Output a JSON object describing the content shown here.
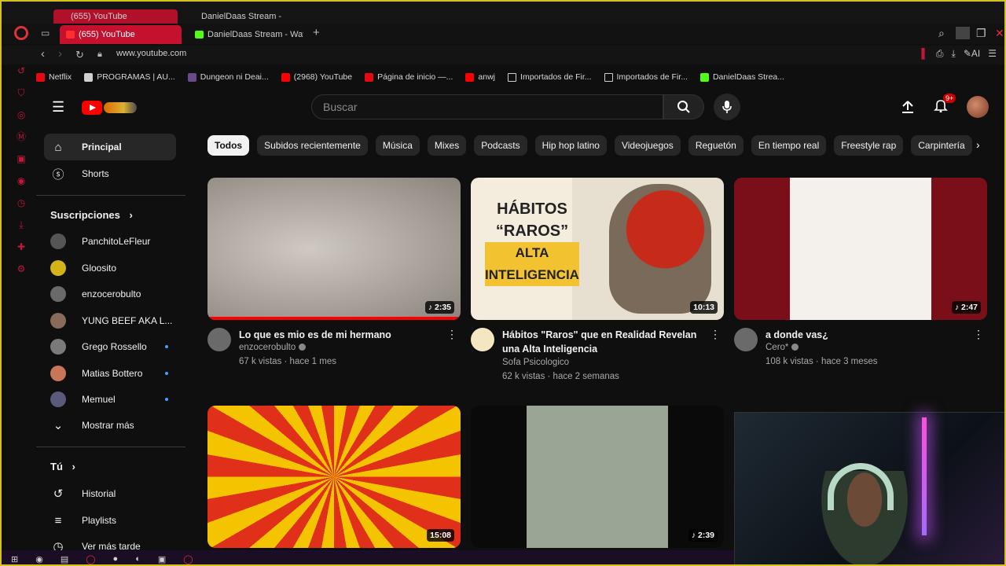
{
  "ghost_tabs": [
    "(655) YouTube",
    "DanielDaas Stream - Watc"
  ],
  "browser": {
    "tabs": [
      {
        "label": "(655) YouTube",
        "active": true
      },
      {
        "label": "DanielDaas Stream - Watc",
        "active": false
      }
    ],
    "url": "www.youtube.com"
  },
  "bookmarks": [
    {
      "label": "Netflix",
      "color": "#e50914"
    },
    {
      "label": "PROGRAMAS | AU...",
      "color": "#cfcfcf"
    },
    {
      "label": "Dungeon ni Deai...",
      "color": "#6b4a8a"
    },
    {
      "label": "(2968) YouTube",
      "color": "#ff0000"
    },
    {
      "label": "Página de inicio —...",
      "color": "#e50914"
    },
    {
      "label": "anwj",
      "color": "#ff0000"
    },
    {
      "label": "Importados de Fir...",
      "color": "folder"
    },
    {
      "label": "Importados de Fir...",
      "color": "folder"
    },
    {
      "label": "DanielDaas Strea...",
      "color": "#53fc18"
    }
  ],
  "header": {
    "search_placeholder": "Buscar",
    "notification_badge": "9+"
  },
  "sidebar": {
    "main": [
      {
        "label": "Principal",
        "icon": "home-icon",
        "active": true
      },
      {
        "label": "Shorts",
        "icon": "shorts-icon",
        "active": false
      }
    ],
    "subscriptions_title": "Suscripciones",
    "subscriptions": [
      {
        "label": "PanchitoLeFleur",
        "color": "#555555",
        "dot": false
      },
      {
        "label": "Gloosito",
        "color": "#d4b21a",
        "dot": false
      },
      {
        "label": "enzocerobulto",
        "color": "#6a6a6a",
        "dot": false
      },
      {
        "label": "YUNG BEEF AKA L...",
        "color": "#8a6a5a",
        "dot": false
      },
      {
        "label": "Grego Rossello",
        "color": "#7a7a7a",
        "dot": true
      },
      {
        "label": "Matias Bottero",
        "color": "#c9755a",
        "dot": true
      },
      {
        "label": "Memuel",
        "color": "#5a5a7a",
        "dot": true
      }
    ],
    "show_more": "Mostrar más",
    "you_title": "Tú",
    "you": [
      {
        "label": "Historial",
        "icon": "history-icon"
      },
      {
        "label": "Playlists",
        "icon": "playlists-icon"
      },
      {
        "label": "Ver más tarde",
        "icon": "watch-later-icon"
      }
    ]
  },
  "chips": [
    "Todos",
    "Subidos recientemente",
    "Música",
    "Mixes",
    "Podcasts",
    "Hip hop latino",
    "Videojuegos",
    "Reguetón",
    "En tiempo real",
    "Freestyle rap",
    "Carpintería"
  ],
  "videos": [
    {
      "title": "Lo que es mio es de mi hermano",
      "channel": "enzocerobulto",
      "verified": true,
      "stats": "67 k vistas · hace 1 mes",
      "duration": "2:35",
      "short": true,
      "watched": 1.0,
      "thumb_colors": [
        "#cfc9c2",
        "#8a847c"
      ]
    },
    {
      "title": "Hábitos \"Raros\" que en Realidad Revelan una Alta Inteligencia",
      "channel": "Sofa Psicologico",
      "verified": false,
      "stats": "62 k vistas · hace 2 semanas",
      "duration": "10:13",
      "short": false,
      "watched": 0,
      "thumb_colors": [
        "#f4ecdc",
        "#c62a1a"
      ],
      "thumb_text": [
        "HÁBITOS",
        "“RAROS”",
        "ALTA",
        "INTELIGENCIA"
      ]
    },
    {
      "title": "a donde vas¿",
      "channel": "Cero*",
      "verified": true,
      "stats": "108 k vistas · hace 3 meses",
      "duration": "2:47",
      "short": true,
      "watched": 0,
      "thumb_colors": [
        "#7a0f1a",
        "#f4f1ec"
      ]
    },
    {
      "title": "",
      "channel": "",
      "verified": false,
      "stats": "",
      "duration": "15:08",
      "short": false,
      "watched": 0,
      "thumb_colors": [
        "#f5c400",
        "#e0301a"
      ]
    },
    {
      "title": "",
      "channel": "",
      "verified": false,
      "stats": "",
      "duration": "2:39",
      "short": true,
      "watched": 0,
      "thumb_colors": [
        "#0a0a0a",
        "#9aa596"
      ]
    }
  ]
}
